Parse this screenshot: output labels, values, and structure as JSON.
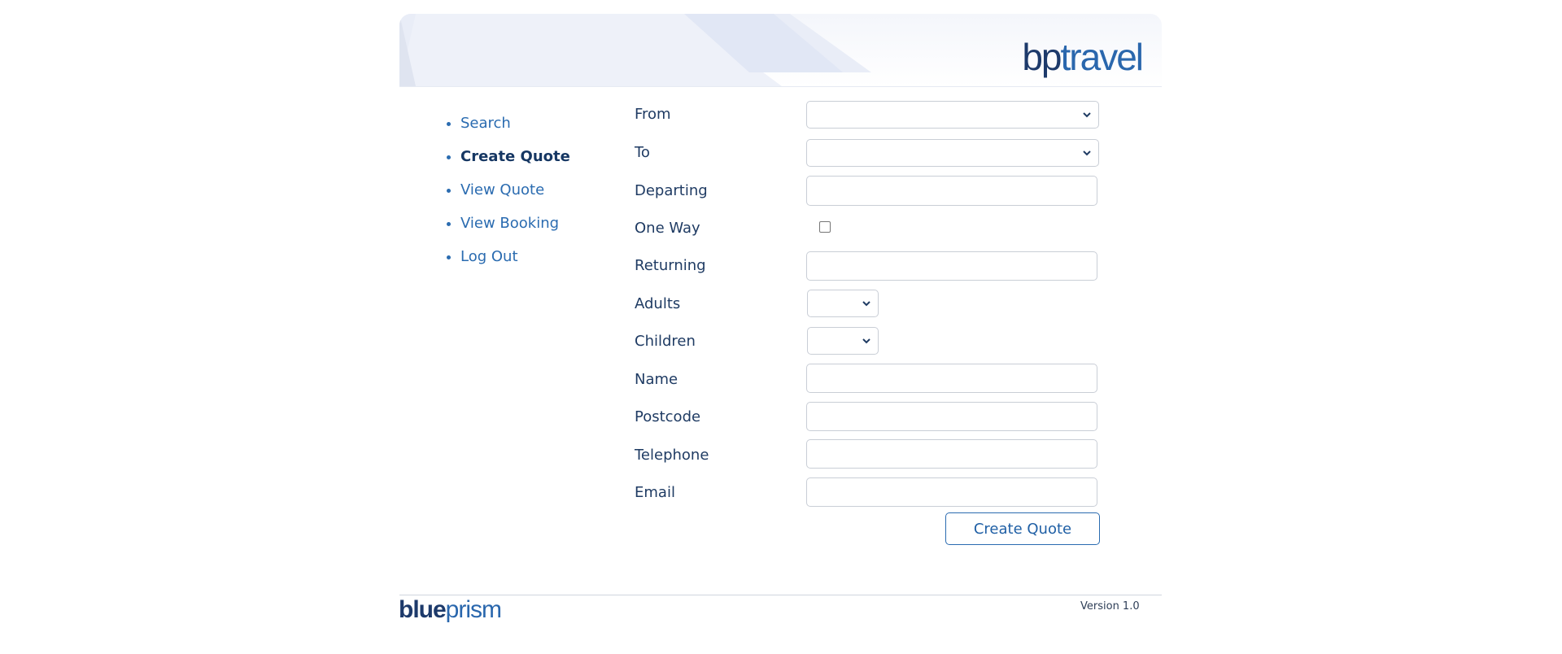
{
  "brand": {
    "part1": "bp",
    "part2": "travel"
  },
  "nav": {
    "items": [
      {
        "label": "Search",
        "active": false
      },
      {
        "label": "Create Quote",
        "active": true
      },
      {
        "label": "View Quote",
        "active": false
      },
      {
        "label": "View Booking",
        "active": false
      },
      {
        "label": "Log Out",
        "active": false
      }
    ]
  },
  "form": {
    "from_label": "From",
    "from_value": "",
    "to_label": "To",
    "to_value": "",
    "departing_label": "Departing",
    "departing_value": "",
    "one_way_label": "One Way",
    "one_way_checked": false,
    "returning_label": "Returning",
    "returning_value": "",
    "adults_label": "Adults",
    "adults_value": "",
    "children_label": "Children",
    "children_value": "",
    "name_label": "Name",
    "name_value": "",
    "postcode_label": "Postcode",
    "postcode_value": "",
    "telephone_label": "Telephone",
    "telephone_value": "",
    "email_label": "Email",
    "email_value": "",
    "submit_label": "Create Quote"
  },
  "footer": {
    "logo_part1": "blue",
    "logo_part2": "prism",
    "version": "Version 1.0"
  },
  "colors": {
    "accent": "#2a6bb0",
    "text": "#1f3b63",
    "brand_dark": "#1d3a6b"
  }
}
